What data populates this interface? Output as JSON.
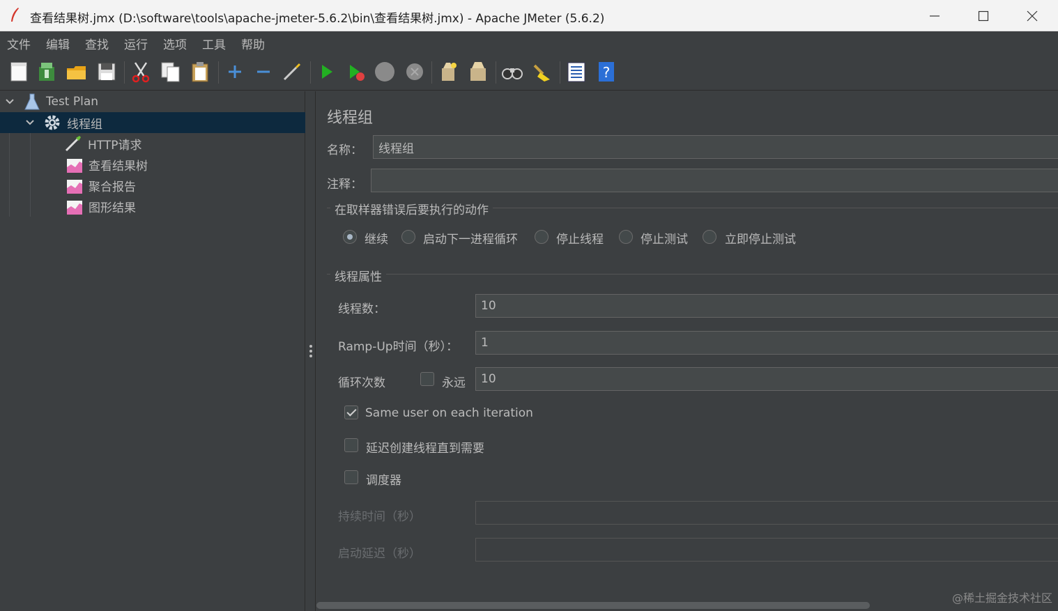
{
  "window": {
    "title": "查看结果树.jmx (D:\\software\\tools\\apache-jmeter-5.6.2\\bin\\查看结果树.jmx) - Apache JMeter (5.6.2)"
  },
  "menu": [
    "文件",
    "编辑",
    "查找",
    "运行",
    "选项",
    "工具",
    "帮助"
  ],
  "toolbar": {
    "buttons": [
      "new-icon",
      "templates-icon",
      "open-icon",
      "save-icon",
      "cut-icon",
      "copy-icon",
      "paste-icon",
      "expand-icon",
      "collapse-icon",
      "toggle-icon",
      "start-icon",
      "start-no-pause-icon",
      "stop-icon",
      "shutdown-icon",
      "clear-icon",
      "clear-all-icon",
      "search-icon",
      "reset-search-icon",
      "function-helper-icon",
      "help-icon"
    ]
  },
  "tree": {
    "test_plan": "Test Plan",
    "thread_group": "线程组",
    "children": [
      "HTTP请求",
      "查看结果树",
      "聚合报告",
      "图形结果"
    ]
  },
  "panel": {
    "heading": "线程组",
    "name_label": "名称：",
    "name_value": "线程组",
    "comment_label": "注释：",
    "comment_value": "",
    "error_group_title": "在取样器错误后要执行的动作",
    "error_actions": [
      "继续",
      "启动下一进程循环",
      "停止线程",
      "停止测试",
      "立即停止测试"
    ],
    "error_selected": 0,
    "props_group_title": "线程属性",
    "threads_label": "线程数：",
    "threads_value": "10",
    "rampup_label": "Ramp-Up时间（秒）：",
    "rampup_value": "1",
    "loop_label": "循环次数",
    "forever_label": "永远",
    "loop_value": "10",
    "same_user_label": "Same user on each iteration",
    "same_user_checked": true,
    "delay_label": "延迟创建线程直到需要",
    "delay_checked": false,
    "scheduler_label": "调度器",
    "scheduler_checked": false,
    "duration_label": "持续时间（秒）",
    "duration_value": "",
    "startup_delay_label": "启动延迟（秒）",
    "startup_delay_value": ""
  },
  "watermark": "@稀土掘金技术社区"
}
